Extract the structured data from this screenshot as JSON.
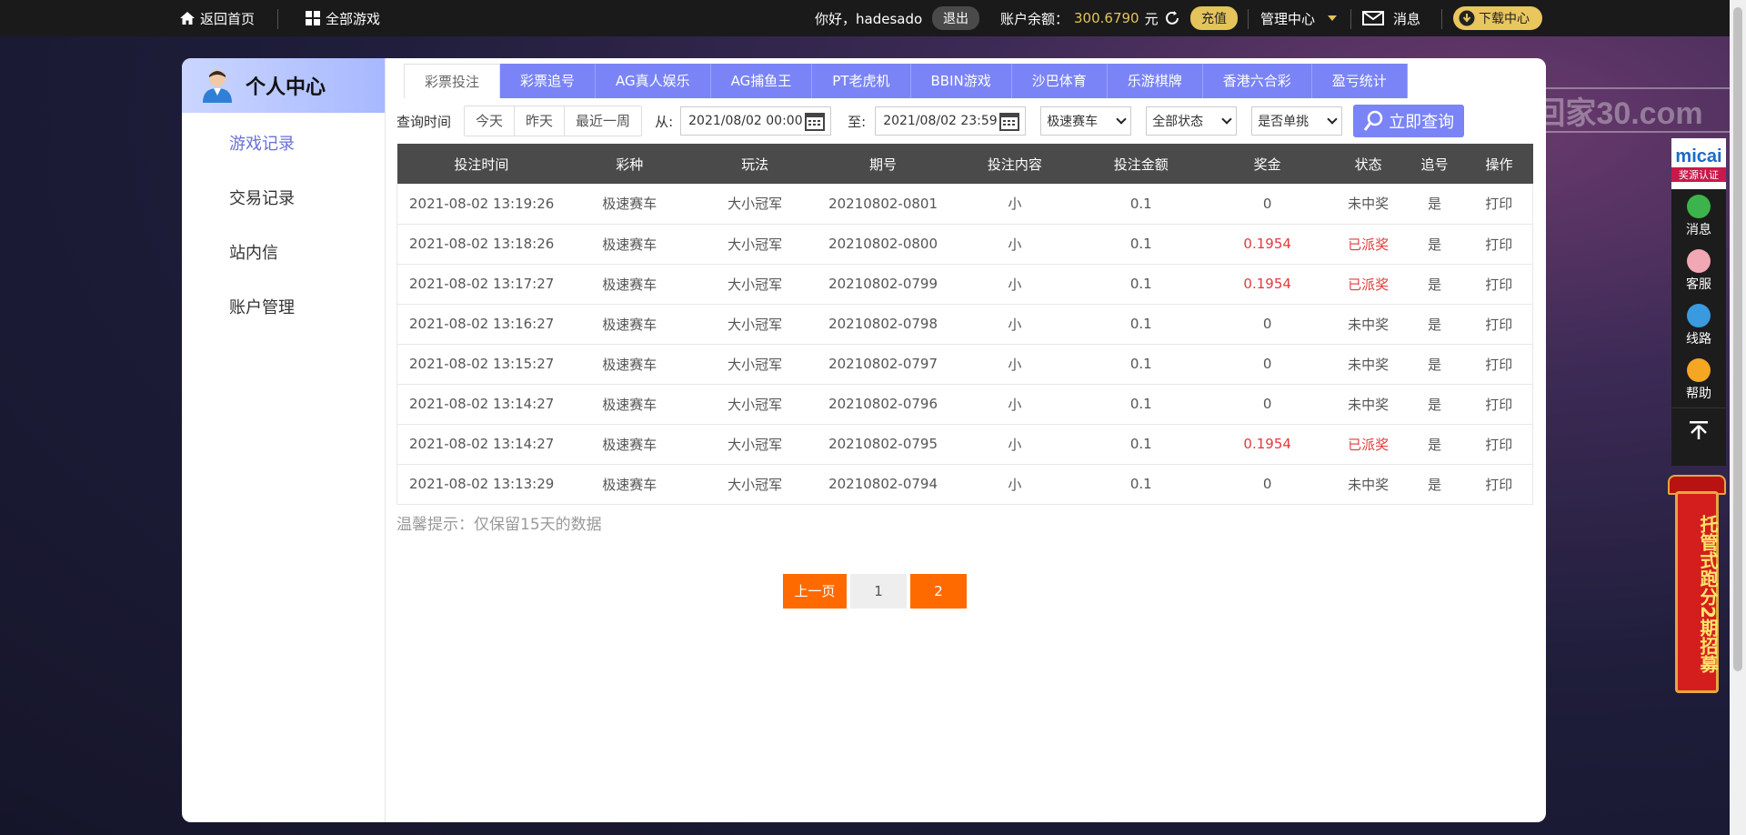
{
  "topbar": {
    "home": "返回首页",
    "all_games": "全部游戏",
    "greeting": "你好，hadesado",
    "logout": "退出",
    "balance_label": "账户余额：",
    "balance_value": "300.6790",
    "balance_unit": "元",
    "recharge": "充值",
    "admin": "管理中心",
    "messages": "消息",
    "download": "下载中心"
  },
  "sidebar": {
    "title": "个人中心",
    "items": [
      {
        "label": "游戏记录"
      },
      {
        "label": "交易记录"
      },
      {
        "label": "站内信"
      },
      {
        "label": "账户管理"
      }
    ]
  },
  "tabs": [
    {
      "label": "彩票投注"
    },
    {
      "label": "彩票追号"
    },
    {
      "label": "AG真人娱乐"
    },
    {
      "label": "AG捕鱼王"
    },
    {
      "label": "PT老虎机"
    },
    {
      "label": "BBIN游戏"
    },
    {
      "label": "沙巴体育"
    },
    {
      "label": "乐游棋牌"
    },
    {
      "label": "香港六合彩"
    },
    {
      "label": "盈亏统计"
    }
  ],
  "filters": {
    "query_label": "查询时间",
    "quick": [
      "今天",
      "昨天",
      "最近一周"
    ],
    "from_label": "从:",
    "from_value": "2021/08/02 00:00",
    "to_label": "至:",
    "to_value": "2021/08/02 23:59",
    "lottery_select": "极速赛车",
    "status_select": "全部状态",
    "single_select": "是否单挑",
    "search_button": "立即查询"
  },
  "table": {
    "headers": [
      "投注时间",
      "彩种",
      "玩法",
      "期号",
      "投注内容",
      "投注金额",
      "奖金",
      "状态",
      "追号",
      "操作"
    ],
    "rows": [
      [
        "2021-08-02 13:19:26",
        "极速赛车",
        "大小冠军",
        "20210802-0801",
        "小",
        "0.1",
        "0",
        "未中奖",
        "是",
        "打印"
      ],
      [
        "2021-08-02 13:18:26",
        "极速赛车",
        "大小冠军",
        "20210802-0800",
        "小",
        "0.1",
        "0.1954",
        "已派奖",
        "是",
        "打印"
      ],
      [
        "2021-08-02 13:17:27",
        "极速赛车",
        "大小冠军",
        "20210802-0799",
        "小",
        "0.1",
        "0.1954",
        "已派奖",
        "是",
        "打印"
      ],
      [
        "2021-08-02 13:16:27",
        "极速赛车",
        "大小冠军",
        "20210802-0798",
        "小",
        "0.1",
        "0",
        "未中奖",
        "是",
        "打印"
      ],
      [
        "2021-08-02 13:15:27",
        "极速赛车",
        "大小冠军",
        "20210802-0797",
        "小",
        "0.1",
        "0",
        "未中奖",
        "是",
        "打印"
      ],
      [
        "2021-08-02 13:14:27",
        "极速赛车",
        "大小冠军",
        "20210802-0796",
        "小",
        "0.1",
        "0",
        "未中奖",
        "是",
        "打印"
      ],
      [
        "2021-08-02 13:14:27",
        "极速赛车",
        "大小冠军",
        "20210802-0795",
        "小",
        "0.1",
        "0.1954",
        "已派奖",
        "是",
        "打印"
      ],
      [
        "2021-08-02 13:13:29",
        "极速赛车",
        "大小冠军",
        "20210802-0794",
        "小",
        "0.1",
        "0",
        "未中奖",
        "是",
        "打印"
      ]
    ]
  },
  "tip": "温馨提示：仅保留15天的数据",
  "pager": {
    "prev": "上一页",
    "pages": [
      "1",
      "2"
    ],
    "current": "2"
  },
  "watermark": "回家30.com",
  "float_bar": {
    "brand": "micai",
    "cert": "奖源认证",
    "items": [
      {
        "label": "消息",
        "icon": "message-icon",
        "color": "#3cb44b"
      },
      {
        "label": "客服",
        "icon": "service-icon",
        "color": "#f2a7b5"
      },
      {
        "label": "线路",
        "icon": "route-icon",
        "color": "#3a9ae0"
      },
      {
        "label": "帮助",
        "icon": "help-icon",
        "color": "#f5a623"
      }
    ]
  },
  "banner": "托管式跑分2期招募",
  "colors": {
    "accent": "#7a84f6",
    "orange": "#ff6a00",
    "win_red": "#e4393c",
    "gold": "#e4c35b"
  }
}
